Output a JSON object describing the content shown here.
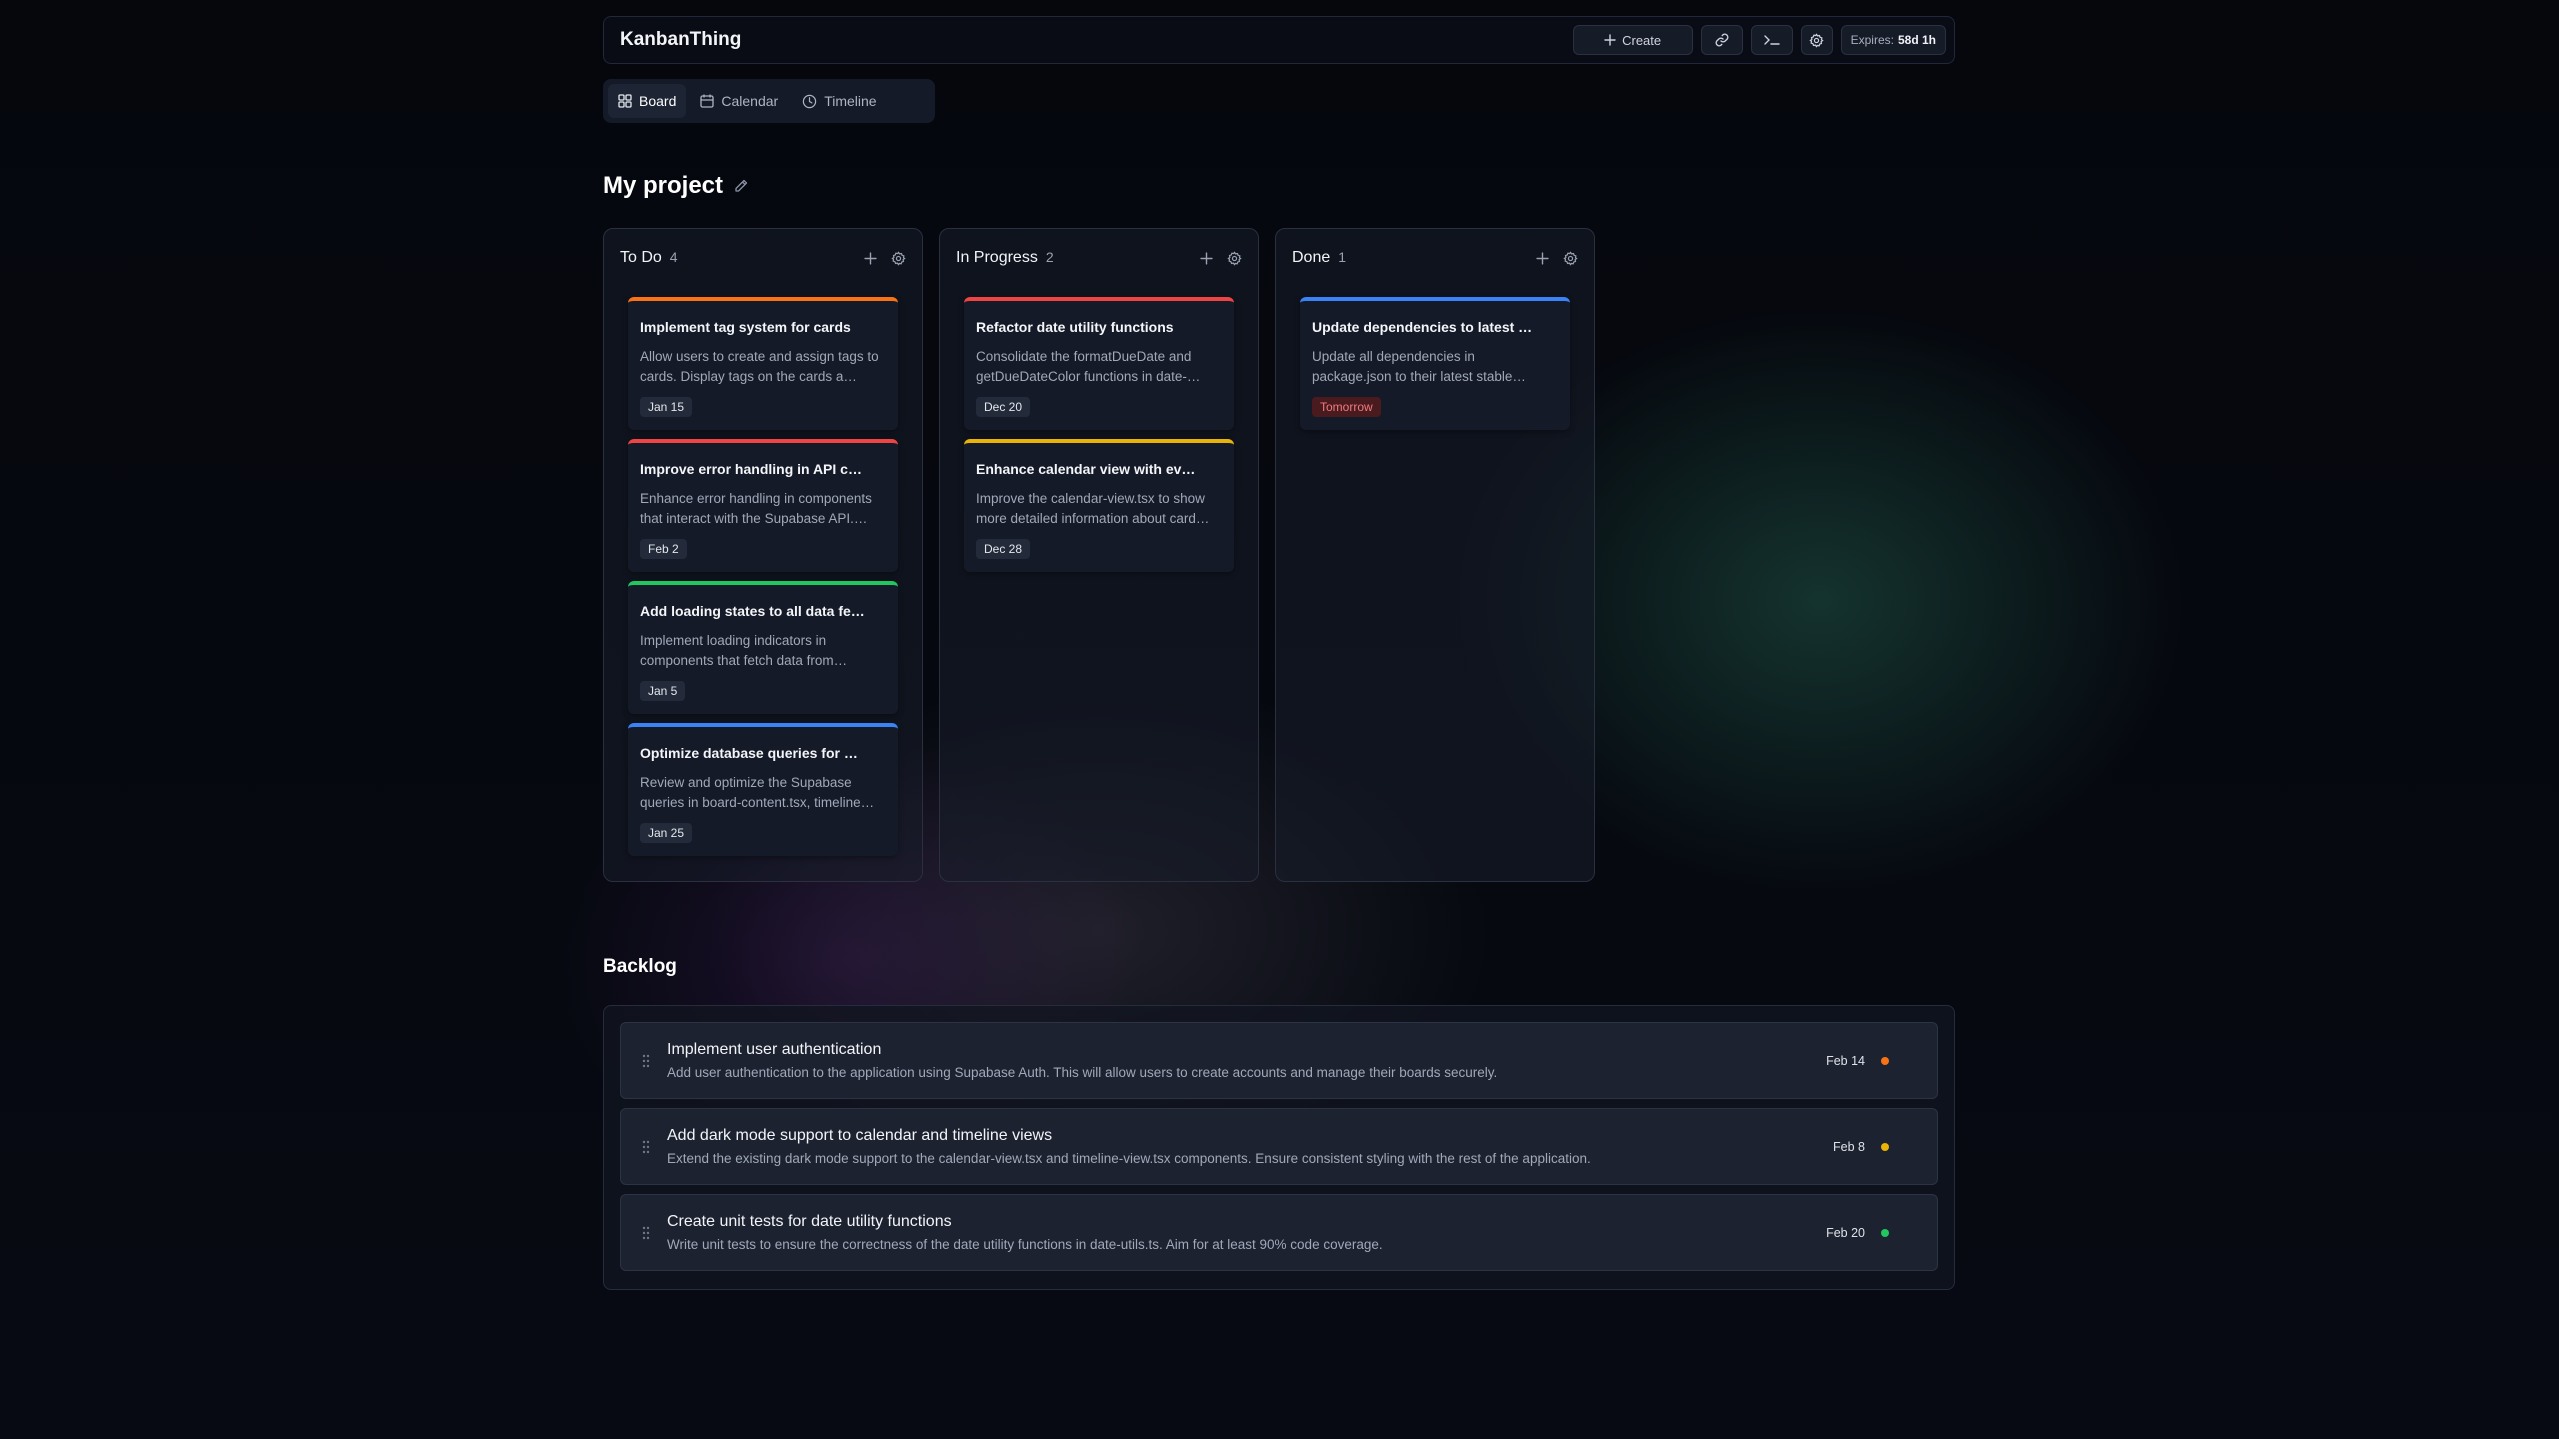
{
  "header": {
    "brand": "KanbanThing",
    "create_label": "Create",
    "expires_label": "Expires:",
    "expires_value": "58d 1h"
  },
  "tabs": [
    {
      "label": "Board",
      "icon": "grid-icon",
      "active": true
    },
    {
      "label": "Calendar",
      "icon": "calendar-icon",
      "active": false
    },
    {
      "label": "Timeline",
      "icon": "clock-icon",
      "active": false
    }
  ],
  "project": {
    "title": "My project"
  },
  "columns": [
    {
      "name": "To Do",
      "count": "4",
      "cards": [
        {
          "title": "Implement tag system for cards",
          "description": "Allow users to create and assign tags to cards. Display tags on the cards a…",
          "date": "Jan 15",
          "color": "#f97316"
        },
        {
          "title": "Improve error handling in API c…",
          "description": "Enhance error handling in components that interact with the Supabase API.…",
          "date": "Feb 2",
          "color": "#ef4444"
        },
        {
          "title": "Add loading states to all data fe…",
          "description": "Implement loading indicators in components that fetch data from…",
          "date": "Jan 5",
          "color": "#22c55e"
        },
        {
          "title": "Optimize database queries for …",
          "description": "Review and optimize the Supabase queries in board-content.tsx, timeline…",
          "date": "Jan 25",
          "color": "#3b82f6"
        }
      ]
    },
    {
      "name": "In Progress",
      "count": "2",
      "cards": [
        {
          "title": "Refactor date utility functions",
          "description": "Consolidate the formatDueDate and getDueDateColor functions in date-…",
          "date": "Dec 20",
          "color": "#ef4444"
        },
        {
          "title": "Enhance calendar view with ev…",
          "description": "Improve the calendar-view.tsx to show more detailed information about card…",
          "date": "Dec 28",
          "color": "#eab308"
        }
      ]
    },
    {
      "name": "Done",
      "count": "1",
      "cards": [
        {
          "title": "Update dependencies to latest …",
          "description": "Update all dependencies in package.json to their latest stable…",
          "date": "Tomorrow",
          "color": "#3b82f6",
          "date_style": "warn"
        }
      ]
    }
  ],
  "backlog": {
    "title": "Backlog",
    "items": [
      {
        "title": "Implement user authentication",
        "description": "Add user authentication to the application using Supabase Auth. This will allow users to create accounts and manage their boards securely.",
        "date": "Feb 14",
        "color": "#f97316"
      },
      {
        "title": "Add dark mode support to calendar and timeline views",
        "description": "Extend the existing dark mode support to the calendar-view.tsx and timeline-view.tsx components. Ensure consistent styling with the rest of the application.",
        "date": "Feb 8",
        "color": "#eab308"
      },
      {
        "title": "Create unit tests for date utility functions",
        "description": "Write unit tests to ensure the correctness of the date utility functions in date-utils.ts. Aim for at least 90% code coverage.",
        "date": "Feb 20",
        "color": "#22c55e"
      }
    ]
  }
}
